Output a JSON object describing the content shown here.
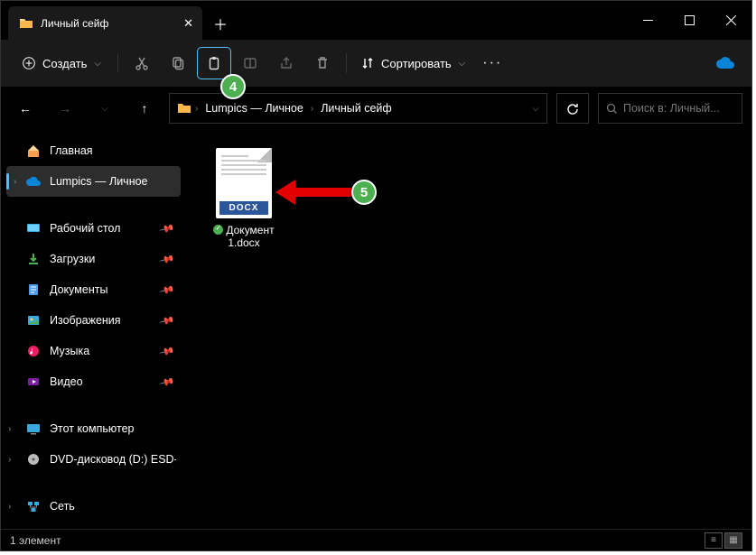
{
  "tab": {
    "title": "Личный сейф"
  },
  "toolbar": {
    "create": "Создать",
    "sort": "Сортировать",
    "more": "···"
  },
  "nav": {
    "crumb1": "Lumpics — Личное",
    "crumb2": "Личный сейф"
  },
  "search": {
    "placeholder": "Поиск в: Личный..."
  },
  "sidebar": {
    "home": "Главная",
    "onedrive": "Lumpics — Личное",
    "desktop": "Рабочий стол",
    "downloads": "Загрузки",
    "documents": "Документы",
    "pictures": "Изображения",
    "music": "Музыка",
    "video": "Видео",
    "thispc": "Этот компьютер",
    "dvd": "DVD-дисковод (D:) ESD-IS",
    "network": "Сеть"
  },
  "file": {
    "name": "Документ 1.docx",
    "ext": "DOCX"
  },
  "status": {
    "count": "1 элемент"
  },
  "badges": {
    "b4": "4",
    "b5": "5"
  }
}
